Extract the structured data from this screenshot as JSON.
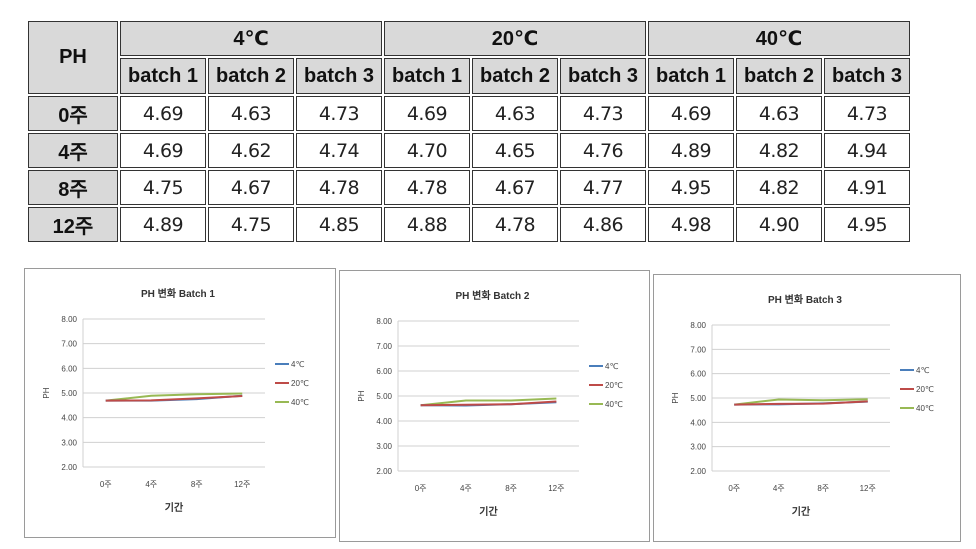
{
  "table": {
    "corner_label": "PH",
    "temperatures": [
      "4℃",
      "20℃",
      "40℃"
    ],
    "batch_labels": [
      "batch 1",
      "batch 2",
      "batch 3"
    ],
    "rows": [
      {
        "label": "0주",
        "values": [
          "4.69",
          "4.63",
          "4.73",
          "4.69",
          "4.63",
          "4.73",
          "4.69",
          "4.63",
          "4.73"
        ]
      },
      {
        "label": "4주",
        "values": [
          "4.69",
          "4.62",
          "4.74",
          "4.70",
          "4.65",
          "4.76",
          "4.89",
          "4.82",
          "4.94"
        ]
      },
      {
        "label": "8주",
        "values": [
          "4.75",
          "4.67",
          "4.78",
          "4.78",
          "4.67",
          "4.77",
          "4.95",
          "4.82",
          "4.91"
        ]
      },
      {
        "label": "12주",
        "values": [
          "4.89",
          "4.75",
          "4.85",
          "4.88",
          "4.78",
          "4.86",
          "4.98",
          "4.90",
          "4.95"
        ]
      }
    ]
  },
  "chart_data": [
    {
      "type": "line",
      "title": "PH 변화 Batch 1",
      "xlabel": "기간",
      "ylabel": "PH",
      "categories": [
        "0주",
        "4주",
        "8주",
        "12주"
      ],
      "ylim": [
        2,
        8
      ],
      "yticks": [
        "2.00",
        "3.00",
        "4.00",
        "5.00",
        "6.00",
        "7.00",
        "8.00"
      ],
      "grid": true,
      "legend": "right",
      "series": [
        {
          "name": "4℃",
          "color": "#4a7ebb",
          "values": [
            4.69,
            4.69,
            4.75,
            4.89
          ]
        },
        {
          "name": "20℃",
          "color": "#be4b48",
          "values": [
            4.69,
            4.7,
            4.78,
            4.88
          ]
        },
        {
          "name": "40℃",
          "color": "#98b954",
          "values": [
            4.69,
            4.89,
            4.95,
            4.98
          ]
        }
      ]
    },
    {
      "type": "line",
      "title": "PH 변화 Batch 2",
      "xlabel": "기간",
      "ylabel": "PH",
      "categories": [
        "0주",
        "4주",
        "8주",
        "12주"
      ],
      "ylim": [
        2,
        8
      ],
      "yticks": [
        "2.00",
        "3.00",
        "4.00",
        "5.00",
        "6.00",
        "7.00",
        "8.00"
      ],
      "grid": true,
      "legend": "right",
      "series": [
        {
          "name": "4℃",
          "color": "#4a7ebb",
          "values": [
            4.63,
            4.62,
            4.67,
            4.75
          ]
        },
        {
          "name": "20℃",
          "color": "#be4b48",
          "values": [
            4.63,
            4.65,
            4.67,
            4.78
          ]
        },
        {
          "name": "40℃",
          "color": "#98b954",
          "values": [
            4.63,
            4.82,
            4.82,
            4.9
          ]
        }
      ]
    },
    {
      "type": "line",
      "title": "PH 변화 Batch 3",
      "xlabel": "기간",
      "ylabel": "PH",
      "categories": [
        "0주",
        "4주",
        "8주",
        "12주"
      ],
      "ylim": [
        2,
        8
      ],
      "yticks": [
        "2.00",
        "3.00",
        "4.00",
        "5.00",
        "6.00",
        "7.00",
        "8.00"
      ],
      "grid": true,
      "legend": "right",
      "series": [
        {
          "name": "4℃",
          "color": "#4a7ebb",
          "values": [
            4.73,
            4.74,
            4.78,
            4.85
          ]
        },
        {
          "name": "20℃",
          "color": "#be4b48",
          "values": [
            4.73,
            4.76,
            4.77,
            4.86
          ]
        },
        {
          "name": "40℃",
          "color": "#98b954",
          "values": [
            4.73,
            4.94,
            4.91,
            4.95
          ]
        }
      ]
    }
  ]
}
